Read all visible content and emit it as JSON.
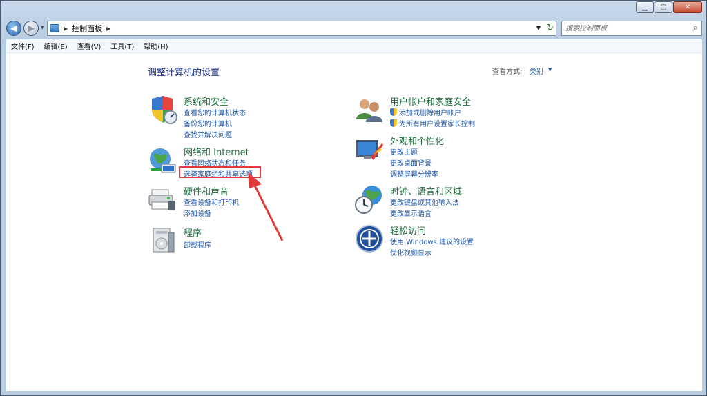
{
  "address": {
    "crumb": "控制面板"
  },
  "search": {
    "placeholder": "搜索控制面板"
  },
  "menu": [
    "文件(F)",
    "编辑(E)",
    "查看(V)",
    "工具(T)",
    "帮助(H)"
  ],
  "page": {
    "title": "调整计算机的设置",
    "view_label": "查看方式:",
    "view_value": "类别"
  },
  "categories": [
    {
      "title": "系统和安全",
      "icon": "system-security-icon",
      "links": [
        "查看您的计算机状态",
        "备份您的计算机",
        "查找并解决问题"
      ]
    },
    {
      "title": "网络和 Internet",
      "icon": "network-icon",
      "links": [
        "查看网络状态和任务",
        "选择家庭组和共享选项"
      ]
    },
    {
      "title": "硬件和声音",
      "icon": "hardware-sound-icon",
      "links": [
        "查看设备和打印机",
        "添加设备"
      ]
    },
    {
      "title": "程序",
      "icon": "programs-icon",
      "links": [
        "卸载程序"
      ]
    },
    {
      "title": "用户帐户和家庭安全",
      "icon": "user-accounts-icon",
      "links": [
        "添加或删除用户帐户",
        "为所有用户设置家长控制"
      ]
    },
    {
      "title": "外观和个性化",
      "icon": "appearance-icon",
      "links": [
        "更改主题",
        "更改桌面背景",
        "调整屏幕分辨率"
      ]
    },
    {
      "title": "时钟、语言和区域",
      "icon": "clock-language-icon",
      "links": [
        "更改键盘或其他输入法",
        "更改显示语言"
      ]
    },
    {
      "title": "轻松访问",
      "icon": "ease-of-access-icon",
      "links": [
        "使用 Windows 建议的设置",
        "优化视频显示"
      ]
    }
  ],
  "colors": {
    "annotation": "#e23a3a",
    "link": "#1f57a8",
    "category": "#1e6e3c"
  }
}
